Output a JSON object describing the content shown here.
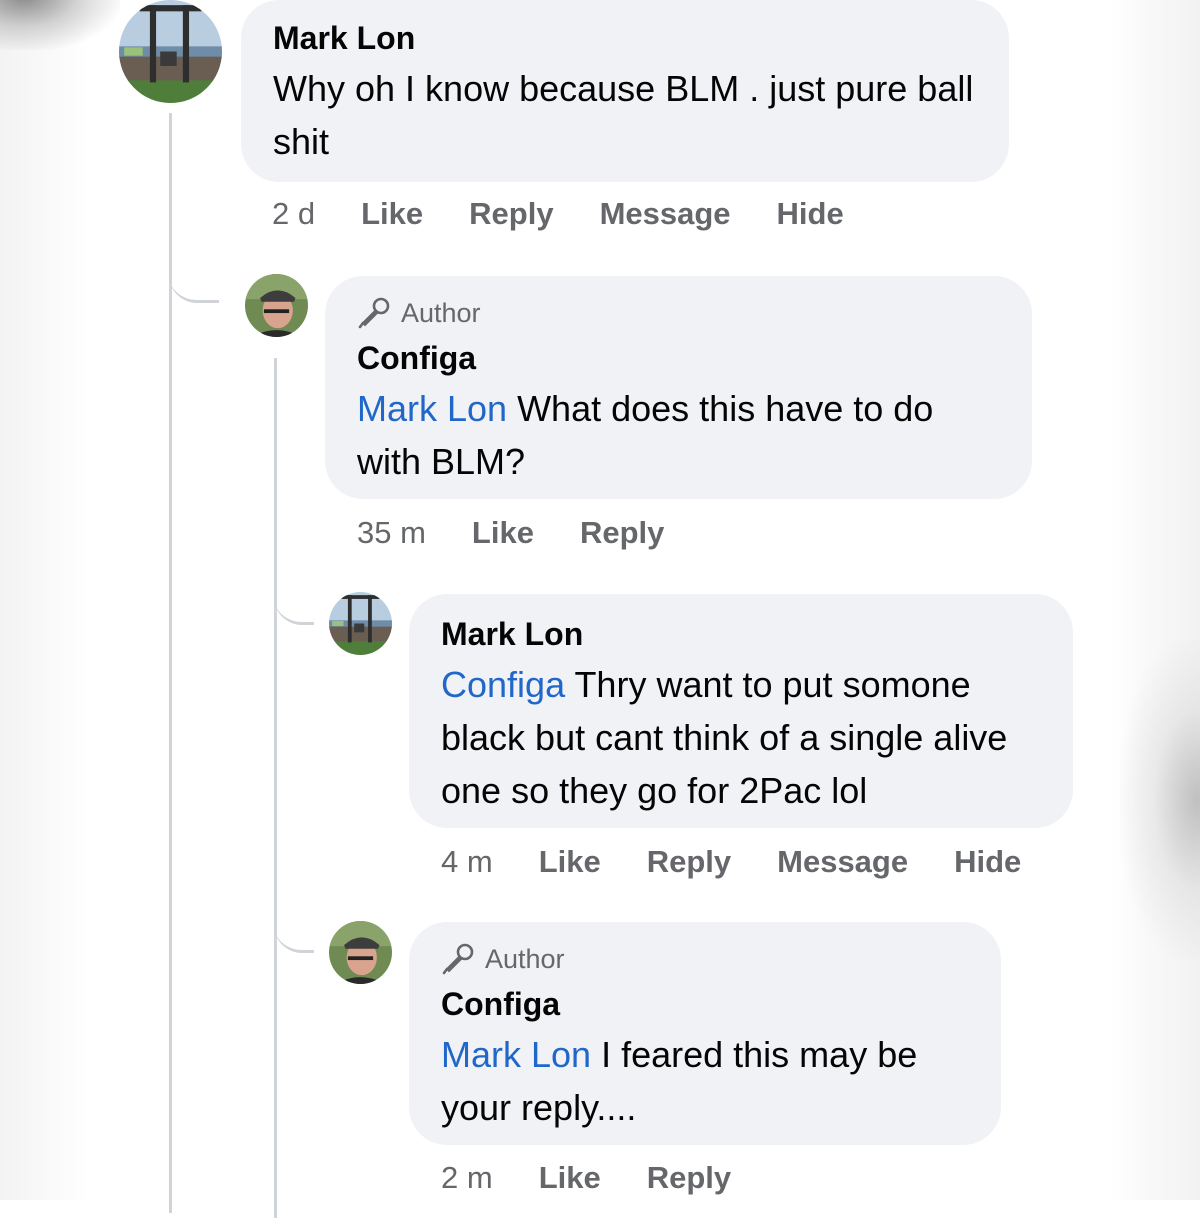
{
  "comments": [
    {
      "name": "Mark Lon",
      "author_badge": "",
      "mention": "",
      "text": "Why oh I know because BLM . just pure ball shit",
      "time": "2 d",
      "actions": [
        "Like",
        "Reply",
        "Message",
        "Hide"
      ]
    },
    {
      "name": "Configa",
      "author_badge": "Author",
      "mention": "Mark Lon",
      "text": " What does this have to do with BLM?",
      "time": "35 m",
      "actions": [
        "Like",
        "Reply"
      ]
    },
    {
      "name": "Mark Lon",
      "author_badge": "",
      "mention": "Configa",
      "text": " Thry want to put somone black but cant think of a single alive one so they go for 2Pac lol",
      "time": "4 m",
      "actions": [
        "Like",
        "Reply",
        "Message",
        "Hide"
      ]
    },
    {
      "name": "Configa",
      "author_badge": "Author",
      "mention": "Mark Lon",
      "text": " I feared this may be your reply....",
      "time": "2 m",
      "actions": [
        "Like",
        "Reply"
      ]
    }
  ],
  "icons": {
    "author_badge_icon": "microphone-icon",
    "avatar_mark": "patio-photo-avatar",
    "avatar_configa": "man-with-cap-avatar"
  },
  "colors": {
    "bubble": "#f0f2f5",
    "mention": "#2167c9",
    "meta": "#65676b",
    "thread_line": "#d0d3d8"
  }
}
